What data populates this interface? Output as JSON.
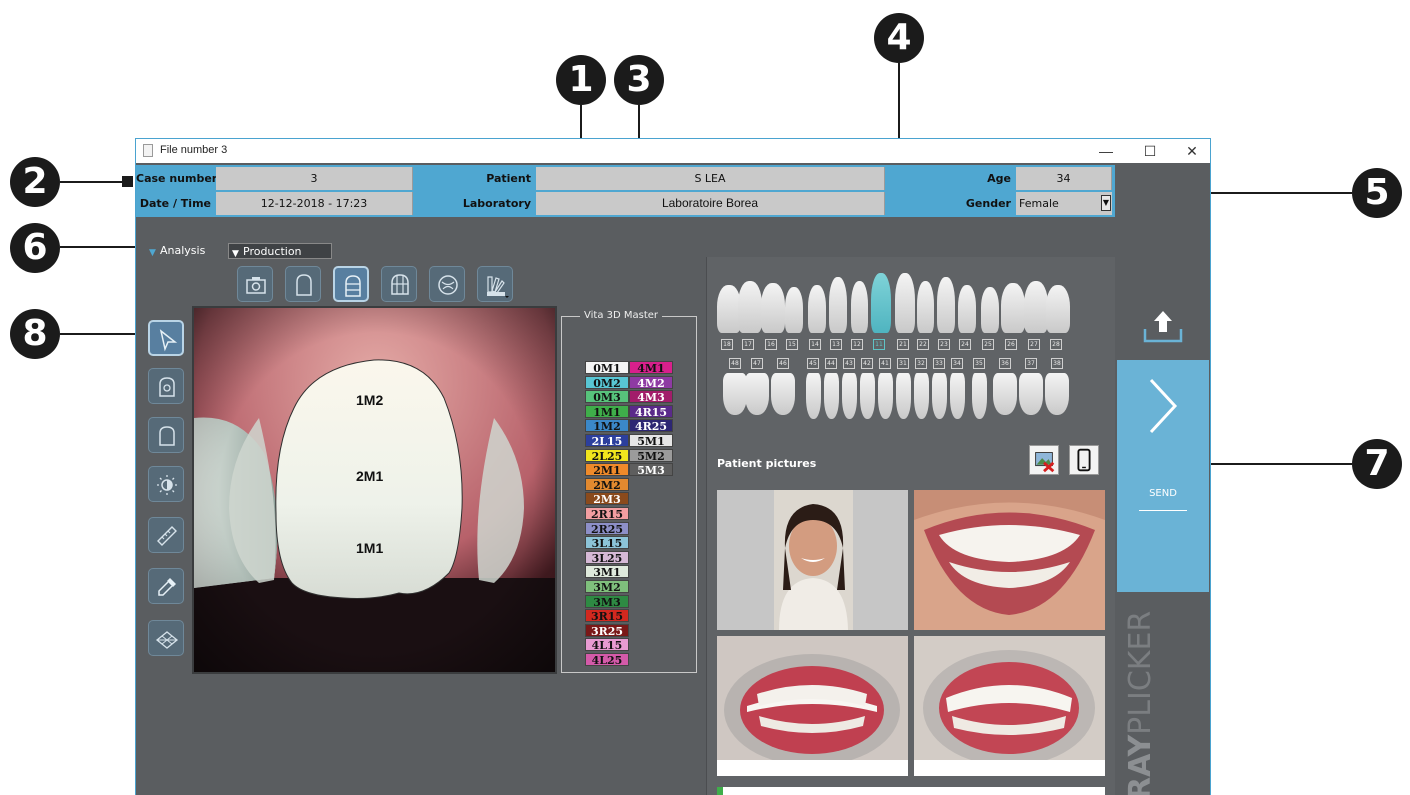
{
  "window": {
    "title": "File number 3",
    "minimize": "—",
    "maximize": "☐",
    "close": "✕"
  },
  "callouts": [
    "1",
    "2",
    "3",
    "4",
    "5",
    "6",
    "7",
    "8"
  ],
  "header": {
    "case_number_label": "Case number",
    "case_number": "3",
    "patient_label": "Patient",
    "patient": "S LEA",
    "age_label": "Age",
    "age": "34",
    "datetime_label": "Date / Time",
    "datetime": "12-12-2018 - 17:23",
    "laboratory_label": "Laboratory",
    "laboratory": "Laboratoire Borea",
    "gender_label": "Gender",
    "gender": "Female"
  },
  "tabs": [
    {
      "label": "Analysis"
    },
    {
      "label": "Production"
    }
  ],
  "photo": {
    "zones": [
      "1M2",
      "2M1",
      "1M1"
    ]
  },
  "shade_guide": {
    "title": "Vita 3D Master",
    "left_col": [
      {
        "code": "0M1",
        "color": "#f4f4f4",
        "text": "#111111"
      },
      {
        "code": "0M2",
        "color": "#58c6d4",
        "text": "#111111"
      },
      {
        "code": "0M3",
        "color": "#57c27b",
        "text": "#111111"
      },
      {
        "code": "1M1",
        "color": "#3fae4a",
        "text": "#111111"
      },
      {
        "code": "1M2",
        "color": "#3b88c8",
        "text": "#111111"
      },
      {
        "code": "2L15",
        "color": "#2c3f9d",
        "text": "#ffffff"
      },
      {
        "code": "2L25",
        "color": "#f1e51d",
        "text": "#111111"
      },
      {
        "code": "2M1",
        "color": "#ef8a2a",
        "text": "#111111"
      },
      {
        "code": "2M2",
        "color": "#e2892f",
        "text": "#111111"
      },
      {
        "code": "2M3",
        "color": "#8a4a1c",
        "text": "#ffffff"
      },
      {
        "code": "2R15",
        "color": "#f29ea1",
        "text": "#111111"
      },
      {
        "code": "2R25",
        "color": "#8d8fc8",
        "text": "#111111"
      },
      {
        "code": "3L15",
        "color": "#8cc4d8",
        "text": "#111111"
      },
      {
        "code": "3L25",
        "color": "#d6b9d6",
        "text": "#111111"
      },
      {
        "code": "3M1",
        "color": "#dfeadc",
        "text": "#111111"
      },
      {
        "code": "3M2",
        "color": "#7fbf7c",
        "text": "#111111"
      },
      {
        "code": "3M3",
        "color": "#2e8a43",
        "text": "#111111"
      },
      {
        "code": "3R15",
        "color": "#d2281f",
        "text": "#111111"
      },
      {
        "code": "3R25",
        "color": "#7a1818",
        "text": "#ffffff"
      },
      {
        "code": "4L15",
        "color": "#e89bd2",
        "text": "#111111"
      },
      {
        "code": "4L25",
        "color": "#d45aa9",
        "text": "#111111"
      }
    ],
    "right_col": [
      {
        "code": "4M1",
        "color": "#d8208c",
        "text": "#111111"
      },
      {
        "code": "4M2",
        "color": "#8e3aa3",
        "text": "#ffffff"
      },
      {
        "code": "4M3",
        "color": "#a21d6a",
        "text": "#ffffff"
      },
      {
        "code": "4R15",
        "color": "#5a2a8a",
        "text": "#ffffff"
      },
      {
        "code": "4R25",
        "color": "#2d2673",
        "text": "#ffffff"
      },
      {
        "code": "5M1",
        "color": "#e6e6e6",
        "text": "#111111"
      },
      {
        "code": "5M2",
        "color": "#9b9b9b",
        "text": "#111111"
      },
      {
        "code": "5M3",
        "color": "#5e5e5e",
        "text": "#ffffff"
      }
    ]
  },
  "teeth": {
    "upper": [
      "18",
      "17",
      "16",
      "15",
      "14",
      "13",
      "12",
      "11",
      "21",
      "22",
      "23",
      "24",
      "25",
      "26",
      "27",
      "28"
    ],
    "lower": [
      "48",
      "47",
      "46",
      "45",
      "44",
      "43",
      "42",
      "41",
      "31",
      "32",
      "33",
      "34",
      "35",
      "36",
      "37",
      "38"
    ],
    "selected": "11",
    "selected_color": "#5fc3c6"
  },
  "patient_pictures": {
    "title": "Patient pictures",
    "count": 4
  },
  "sidebar": {
    "send_label": "SEND",
    "brand_bold": "RAY",
    "brand_light": "PLICKER"
  },
  "colors": {
    "accent": "#4fa7d1",
    "panel": "#5a5d60",
    "send": "#6ab3d6"
  }
}
